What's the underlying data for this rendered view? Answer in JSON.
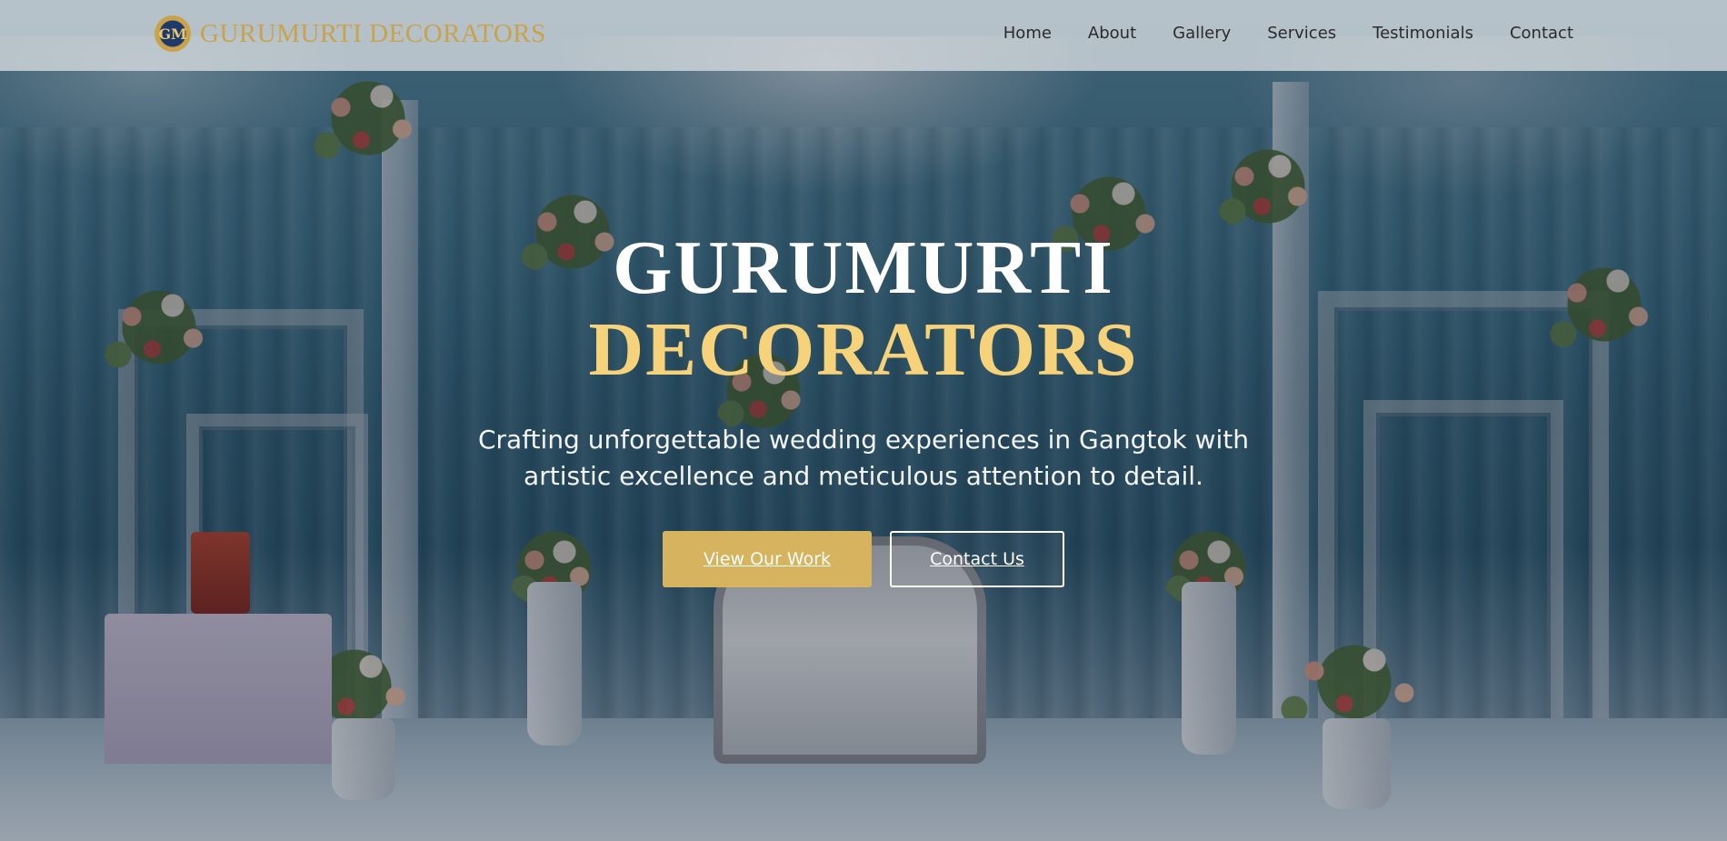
{
  "brand": {
    "logo_text": "GM",
    "name": "GURUMURTI DECORATORS"
  },
  "nav": {
    "items": [
      {
        "label": "Home"
      },
      {
        "label": "About"
      },
      {
        "label": "Gallery"
      },
      {
        "label": "Services"
      },
      {
        "label": "Testimonials"
      },
      {
        "label": "Contact"
      }
    ]
  },
  "hero": {
    "title_line1": "GURUMURTI",
    "title_line2": "DECORATORS",
    "subtitle": "Crafting unforgettable wedding experiences in Gangtok with artistic excellence and meticulous attention to detail.",
    "primary_button": "View Our Work",
    "secondary_button": "Contact Us"
  },
  "colors": {
    "accent_gold": "#d6b45f",
    "title_gold": "#f6d27a",
    "brand_gold": "#c9a24a",
    "nav_text": "#2b2b2b"
  }
}
